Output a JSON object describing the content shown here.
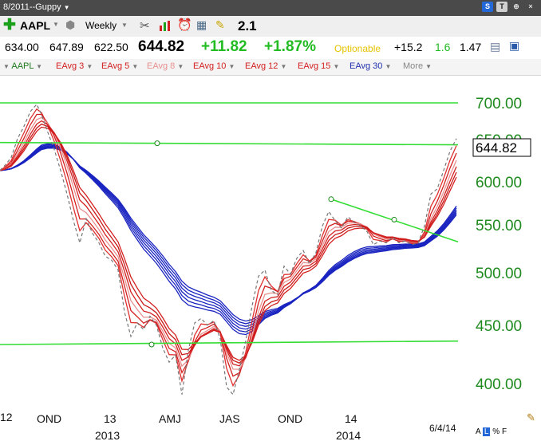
{
  "title_bar": {
    "title": "8/2011--Guppy",
    "buttons": [
      "S",
      "T",
      "⊕",
      "×"
    ]
  },
  "toolbar": {
    "symbol": "AAPL",
    "period": "Weekly",
    "zoom_value": "2.1"
  },
  "quote": {
    "open": "634.00",
    "high": "647.89",
    "low": "622.50",
    "last": "644.82",
    "change": "+11.82",
    "change_pct": "+1.87%",
    "optionable": "Optionable",
    "v1": "+15.2",
    "v2": "1.6",
    "v3": "1.47"
  },
  "legend": {
    "items": [
      {
        "label": "AAPL",
        "color": "#1e7a1e"
      },
      {
        "label": "EAvg 3",
        "color": "#d42020"
      },
      {
        "label": "EAvg 5",
        "color": "#d42020"
      },
      {
        "label": "EAvg 8",
        "color": "#e89090"
      },
      {
        "label": "EAvg 10",
        "color": "#d42020"
      },
      {
        "label": "EAvg 12",
        "color": "#d42020"
      },
      {
        "label": "EAvg 15",
        "color": "#d42020"
      },
      {
        "label": "EAvg 30",
        "color": "#2030b0"
      }
    ],
    "more": "More"
  },
  "chart_data": {
    "type": "line",
    "title": "",
    "xlabel": "",
    "ylabel": "",
    "ylim": [
      380,
      710
    ],
    "y_ticks": [
      "700.00",
      "650.00",
      "600.00",
      "550.00",
      "500.00",
      "450.00",
      "400.00"
    ],
    "y_tick_values": [
      700,
      650,
      600,
      550,
      500,
      450,
      400
    ],
    "x_ticks": [
      "12",
      "OND",
      "13",
      "AMJ",
      "JAS",
      "OND",
      "14",
      "2013",
      "2014"
    ],
    "last_price_label": "644.82",
    "date_label": "6/4/14",
    "price": [
      [
        0,
        612
      ],
      [
        6,
        618
      ],
      [
        14,
        628
      ],
      [
        22,
        652
      ],
      [
        30,
        668
      ],
      [
        38,
        688
      ],
      [
        46,
        698
      ],
      [
        52,
        684
      ],
      [
        60,
        660
      ],
      [
        68,
        638
      ],
      [
        76,
        612
      ],
      [
        84,
        584
      ],
      [
        92,
        554
      ],
      [
        100,
        530
      ],
      [
        108,
        556
      ],
      [
        116,
        540
      ],
      [
        124,
        530
      ],
      [
        132,
        516
      ],
      [
        140,
        512
      ],
      [
        148,
        502
      ],
      [
        156,
        462
      ],
      [
        164,
        440
      ],
      [
        172,
        452
      ],
      [
        180,
        446
      ],
      [
        188,
        458
      ],
      [
        196,
        450
      ],
      [
        204,
        430
      ],
      [
        212,
        418
      ],
      [
        220,
        424
      ],
      [
        228,
        392
      ],
      [
        236,
        428
      ],
      [
        244,
        452
      ],
      [
        252,
        456
      ],
      [
        260,
        450
      ],
      [
        268,
        454
      ],
      [
        276,
        438
      ],
      [
        284,
        398
      ],
      [
        292,
        392
      ],
      [
        300,
        412
      ],
      [
        308,
        436
      ],
      [
        316,
        468
      ],
      [
        324,
        496
      ],
      [
        332,
        502
      ],
      [
        340,
        482
      ],
      [
        348,
        478
      ],
      [
        356,
        506
      ],
      [
        364,
        498
      ],
      [
        372,
        514
      ],
      [
        380,
        522
      ],
      [
        388,
        508
      ],
      [
        396,
        520
      ],
      [
        404,
        548
      ],
      [
        412,
        564
      ],
      [
        420,
        554
      ],
      [
        428,
        546
      ],
      [
        436,
        558
      ],
      [
        444,
        552
      ],
      [
        452,
        548
      ],
      [
        460,
        542
      ],
      [
        468,
        528
      ],
      [
        476,
        532
      ],
      [
        484,
        530
      ],
      [
        492,
        536
      ],
      [
        500,
        530
      ],
      [
        508,
        532
      ],
      [
        516,
        528
      ],
      [
        524,
        530
      ],
      [
        532,
        548
      ],
      [
        540,
        584
      ],
      [
        548,
        590
      ],
      [
        556,
        612
      ],
      [
        564,
        636
      ],
      [
        572,
        652
      ]
    ],
    "horizontal_lines": [
      {
        "x1": 0,
        "y1": 700,
        "x2": 574,
        "y2": 700
      },
      {
        "x1": 0,
        "y1": 647,
        "x2": 574,
        "y2": 644
      },
      {
        "x1": 0,
        "y1": 433,
        "x2": 574,
        "y2": 436
      }
    ],
    "trendline": {
      "x1": 415,
      "y1": 578,
      "x2": 574,
      "y2": 531
    },
    "markers": [
      [
        197,
        646
      ],
      [
        190,
        433
      ],
      [
        415,
        578
      ],
      [
        494,
        555
      ]
    ]
  }
}
